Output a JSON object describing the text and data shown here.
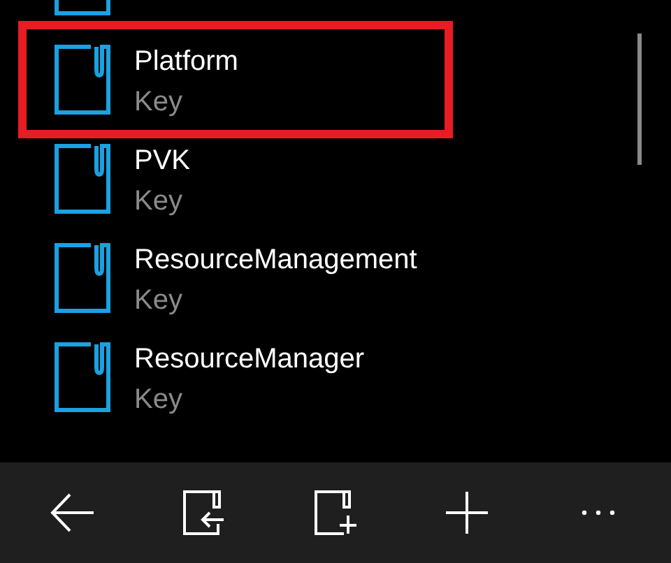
{
  "items": [
    {
      "selected": false
    },
    {
      "name": "Platform",
      "type": "Key",
      "selected": true
    },
    {
      "name": "PVK",
      "type": "Key",
      "selected": false
    },
    {
      "name": "ResourceManagement",
      "type": "Key",
      "selected": false
    },
    {
      "name": "ResourceManager",
      "type": "Key",
      "selected": false
    }
  ]
}
